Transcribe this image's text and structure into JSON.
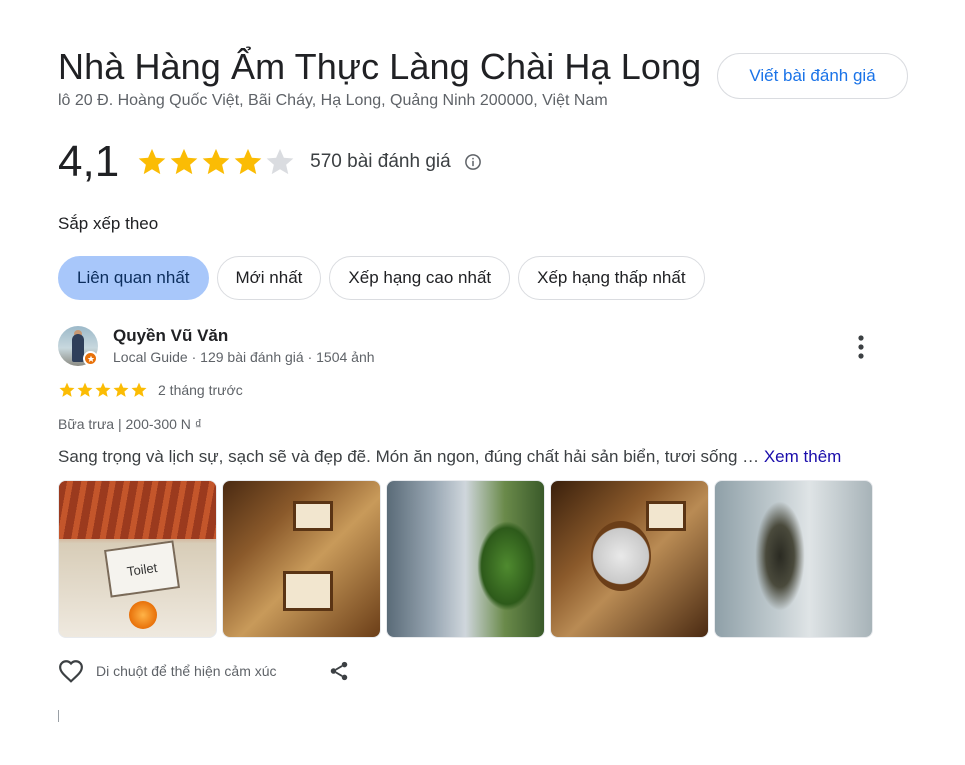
{
  "place": {
    "title": "Nhà Hàng Ẩm Thực Làng Chài Hạ Long",
    "address": "lô 20 Đ. Hoàng Quốc Việt, Bãi Cháy, Hạ Long, Quảng Ninh 200000, Việt Nam",
    "write_review_label": "Viết bài đánh giá"
  },
  "summary": {
    "rating": "4,1",
    "rating_value": 4.1,
    "stars_filled": 4,
    "stars_total": 5,
    "review_count": "570 bài đánh giá"
  },
  "sort": {
    "label": "Sắp xếp theo",
    "options": [
      {
        "label": "Liên quan nhất",
        "active": true
      },
      {
        "label": "Mới nhất",
        "active": false
      },
      {
        "label": "Xếp hạng cao nhất",
        "active": false
      },
      {
        "label": "Xếp hạng thấp nhất",
        "active": false
      }
    ]
  },
  "review": {
    "author": "Quyền Vũ Văn",
    "author_meta": "Local Guide · 129 bài đánh giá · 1504 ảnh",
    "stars": 5,
    "time": "2 tháng trước",
    "meal_info": "Bữa trưa  |  200-300 N ₫",
    "text": "Sang trọng và lịch sự, sạch sẽ và đẹp đẽ. Món ăn ngon, đúng chất hải sản biển, tươi sống … ",
    "see_more": "Xem thêm",
    "photos": [
      {
        "icon": "toilet-photo",
        "sign_text": "Toilet"
      },
      {
        "icon": "interior-photo"
      },
      {
        "icon": "garden-photo"
      },
      {
        "icon": "dining-table-photo"
      },
      {
        "icon": "lobster-tank-photo"
      }
    ],
    "reaction_hint": "Di chuột để thể hiện cảm xúc"
  },
  "colors": {
    "star": "#fbbc04",
    "star_empty": "#dadce0",
    "accent": "#1a73e8",
    "chip_active_bg": "#a8c7fa",
    "link": "#1a0dab",
    "local_guide_badge": "#e8710a"
  }
}
